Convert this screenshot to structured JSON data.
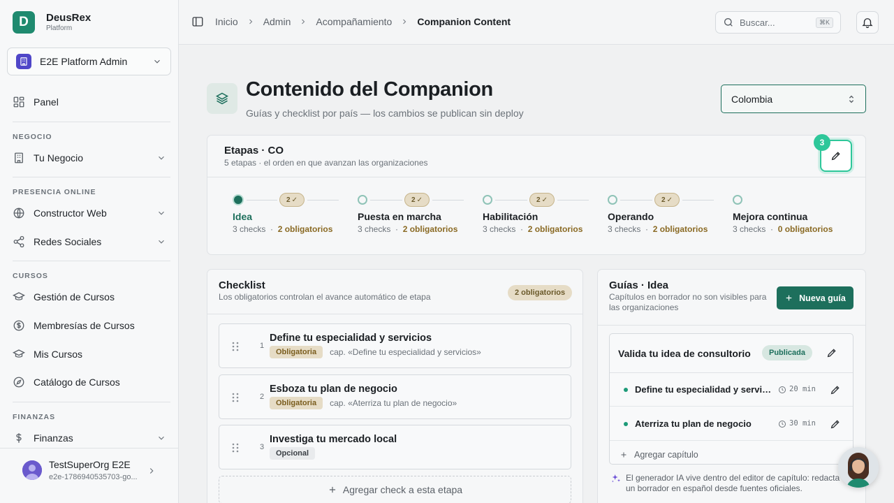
{
  "brand": {
    "initial": "D",
    "name": "DeusRex",
    "subtitle": "Platform"
  },
  "org_selector": {
    "name": "E2E Platform Admin"
  },
  "sidebar": {
    "panel": "Panel",
    "sections": [
      {
        "title": "NEGOCIO",
        "items": [
          {
            "label": "Tu Negocio"
          }
        ]
      },
      {
        "title": "PRESENCIA ONLINE",
        "items": [
          {
            "label": "Constructor Web"
          },
          {
            "label": "Redes Sociales"
          }
        ]
      },
      {
        "title": "CURSOS",
        "items": [
          {
            "label": "Gestión de Cursos"
          },
          {
            "label": "Membresías de Cursos"
          },
          {
            "label": "Mis Cursos"
          },
          {
            "label": "Catálogo de Cursos"
          }
        ]
      },
      {
        "title": "FINANZAS",
        "items": [
          {
            "label": "Finanzas"
          }
        ]
      }
    ]
  },
  "user": {
    "name": "TestSuperOrg E2E",
    "email": "e2e-1786940535703-go..."
  },
  "breadcrumb": [
    "Inicio",
    "Admin",
    "Acompañamiento",
    "Companion Content"
  ],
  "search": {
    "placeholder": "Buscar...",
    "shortcut": "⌘K"
  },
  "page": {
    "title": "Contenido del Companion",
    "subtitle": "Guías y checklist por país — los cambios se publican sin deploy",
    "country": "Colombia"
  },
  "stages": {
    "title": "Etapas · CO",
    "subtitle": "5 etapas · el orden en que avanzan las organizaciones",
    "step_number": "3",
    "items": [
      {
        "name": "Idea",
        "checks": "3 checks",
        "required": "2 obligatorios",
        "badge": "2"
      },
      {
        "name": "Puesta en marcha",
        "checks": "3 checks",
        "required": "2 obligatorios",
        "badge": "2"
      },
      {
        "name": "Habilitación",
        "checks": "3 checks",
        "required": "2 obligatorios",
        "badge": "2"
      },
      {
        "name": "Operando",
        "checks": "3 checks",
        "required": "2 obligatorios",
        "badge": "2"
      },
      {
        "name": "Mejora continua",
        "checks": "3 checks",
        "required": "0 obligatorios"
      }
    ]
  },
  "checklist": {
    "title": "Checklist",
    "subtitle": "Los obligatorios controlan el avance automático de etapa",
    "badge": "2 obligatorios",
    "items": [
      {
        "num": "1",
        "title": "Define tu especialidad y servicios",
        "tag": "Obligatoria",
        "cap": "cap. «Define tu especialidad y servicios»"
      },
      {
        "num": "2",
        "title": "Esboza tu plan de negocio",
        "tag": "Obligatoria",
        "cap": "cap. «Aterriza tu plan de negocio»"
      },
      {
        "num": "3",
        "title": "Investiga tu mercado local",
        "tag": "Opcional",
        "cap": ""
      }
    ],
    "add_label": "Agregar check a esta etapa"
  },
  "guides": {
    "title": "Guías · Idea",
    "subtitle_1": "Capítulos en borrador no son visibles para",
    "subtitle_2": "las organizaciones",
    "new_label": "Nueva guía",
    "guide": {
      "title": "Valida tu idea de consultorio",
      "status": "Publicada",
      "chapters": [
        {
          "title": "Define tu especialidad y servicios",
          "minutes": "20 min"
        },
        {
          "title": "Aterriza tu plan de negocio",
          "minutes": "30 min"
        }
      ],
      "add_chapter": "Agregar capítulo"
    },
    "ai_note_1": "El generador IA vive dentro del editor de capítulo: redacta",
    "ai_note_2": "un borrador en español desde fuentes oficiales."
  },
  "colors": {
    "brand": "#1f8a6f",
    "primary": "#1d6f5c",
    "accent": "#2ec79a",
    "amber": "#8a6a24"
  },
  "icons": [
    "sidebar-toggle-icon",
    "search-icon",
    "bell-icon",
    "layers-icon",
    "pencil-icon",
    "grip-icon",
    "clock-icon",
    "plus-icon",
    "sparkles-icon",
    "chevron-down-icon",
    "chevron-right-icon"
  ]
}
